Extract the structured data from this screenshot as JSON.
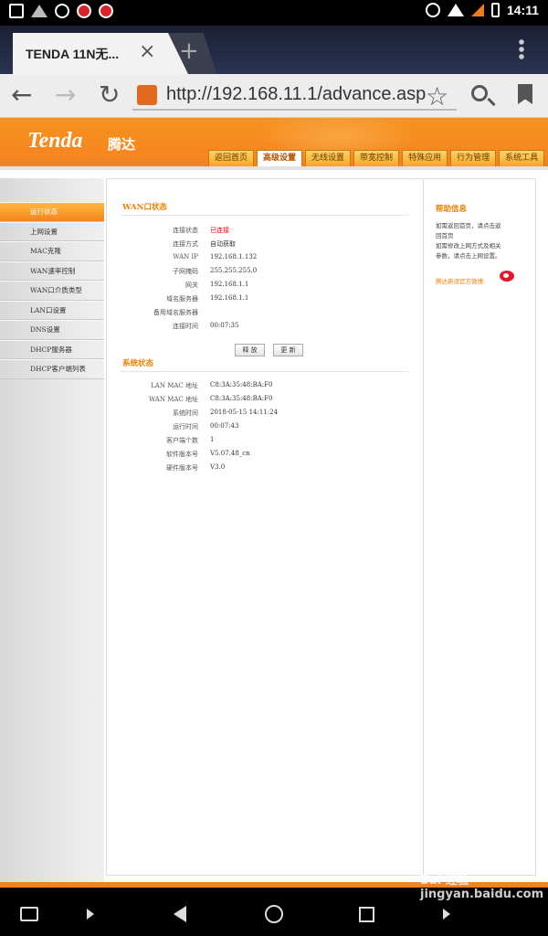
{
  "status_bar": {
    "time": "14:11"
  },
  "browser": {
    "tab_title": "TENDA 11N无...",
    "url": "http://192.168.11.1/advance.asp"
  },
  "router": {
    "logo": "Tenda",
    "logo_cn": "腾达",
    "nav": [
      "返回首页",
      "高级设置",
      "无线设置",
      "带宽控制",
      "特殊应用",
      "行为管理",
      "系统工具"
    ],
    "nav_active": "高级设置",
    "sidebar": [
      "运行状态",
      "上网设置",
      "MAC克隆",
      "WAN速率控制",
      "WAN口介质类型",
      "LAN口设置",
      "DNS设置",
      "DHCP服务器",
      "DHCP客户端列表"
    ],
    "sidebar_active": "运行状态",
    "wan": {
      "title": "WAN口状态",
      "rows": [
        {
          "k": "连接状态",
          "v": "已连接"
        },
        {
          "k": "连接方式",
          "v": "自动获取"
        },
        {
          "k": "WAN IP",
          "v": "192.168.1.132"
        },
        {
          "k": "子网掩码",
          "v": "255.255.255.0"
        },
        {
          "k": "网关",
          "v": "192.168.1.1"
        },
        {
          "k": "域名服务器",
          "v": "192.168.1.1"
        },
        {
          "k": "备用域名服务器",
          "v": ""
        },
        {
          "k": "连接时间",
          "v": "00:07:35"
        }
      ],
      "release_label": "释 放",
      "renew_label": "更 新"
    },
    "system": {
      "title": "系统状态",
      "rows": [
        {
          "k": "LAN MAC 地址",
          "v": "C8:3A:35:48:BA:F0"
        },
        {
          "k": "WAN MAC 地址",
          "v": "C8:3A:35:48:BA:F0"
        },
        {
          "k": "系统时间",
          "v": "2018-05-15 14:11:24"
        },
        {
          "k": "运行时间",
          "v": "00:07:43"
        },
        {
          "k": "客户端个数",
          "v": "1"
        },
        {
          "k": "软件版本号",
          "v": "V5.07.48_cn"
        },
        {
          "k": "硬件版本号",
          "v": "V3.0"
        }
      ]
    },
    "help": {
      "title": "帮助信息",
      "text": "如需返回首页，请点击返回首页\n如需修改上网方式及相关参数，请点击上网设置。",
      "weibo": "腾达新浪官方微博:"
    }
  },
  "watermark": "Bai 经验 jingyan.baidu.com"
}
